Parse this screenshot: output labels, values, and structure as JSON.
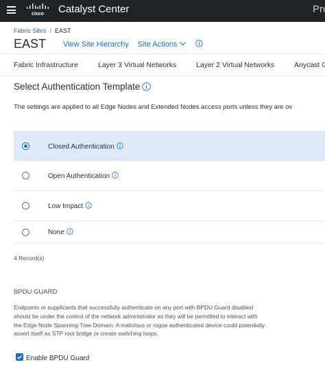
{
  "topbar": {
    "app_title": "Catalyst Center",
    "right_text": "Pro",
    "logo_text": "cisco"
  },
  "breadcrumb": {
    "parent": "Fabric Sites",
    "separator": "/",
    "current": "EAST"
  },
  "header": {
    "site_name": "EAST",
    "view_hierarchy": "View Site Hierarchy",
    "site_actions": "Site Actions"
  },
  "tabs": [
    {
      "label": "Fabric Infrastructure"
    },
    {
      "label": "Layer 3 Virtual Networks"
    },
    {
      "label": "Layer 2 Virtual Networks"
    },
    {
      "label": "Anycast G"
    }
  ],
  "auth_template": {
    "title": "Select Authentication Template",
    "description": "The settings are applied to all Edge Nodes and Extended Nodes access ports unless they are ov",
    "options": [
      {
        "label": "Closed Authentication",
        "selected": true
      },
      {
        "label": "Open Authentication",
        "selected": false
      },
      {
        "label": "Low Impact",
        "selected": false
      },
      {
        "label": "None",
        "selected": false
      }
    ],
    "record_count": "4 Record(s)"
  },
  "bpdu_guard": {
    "heading": "BPDU GUARD",
    "description_lines": [
      "Endpoints or supplicants that successfully authenticate on any port with BPDU Guard disabled",
      "should be under the control of the network administrator as they will be permitted to interact with",
      "the Edge Node Spanning-Tree Domain. A malicious or rogue authenticated device could potentially",
      "assert itself as STP root bridge or create switching loops."
    ],
    "checkbox_label": "Enable BPDU Guard",
    "checked": true
  },
  "colors": {
    "topbar_bg": "#1f2328",
    "link": "#1d69cc",
    "selected_row": "#dfeaf8"
  }
}
